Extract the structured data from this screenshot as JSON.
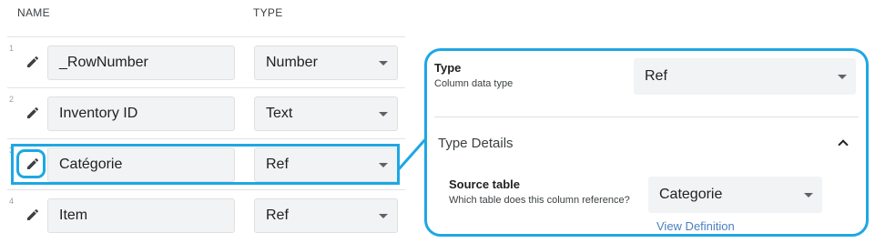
{
  "columns_header": {
    "name": "NAME",
    "type": "TYPE"
  },
  "rows": [
    {
      "index": "1",
      "name": "_RowNumber",
      "type": "Number"
    },
    {
      "index": "2",
      "name": "Inventory ID",
      "type": "Text"
    },
    {
      "index": "3",
      "name": "Catégorie",
      "type": "Ref"
    },
    {
      "index": "4",
      "name": "Item",
      "type": "Ref"
    }
  ],
  "highlighted_row": "3",
  "panel": {
    "type_label": "Type",
    "type_desc": "Column data type",
    "type_value": "Ref",
    "section_title": "Type Details",
    "source_table_label": "Source table",
    "source_table_desc": "Which table does this column reference?",
    "source_table_value": "Categorie",
    "view_definition": "View Definition"
  },
  "colors": {
    "highlight": "#1ea7e4",
    "link": "#4a7fc1",
    "field_bg": "#f1f3f4"
  },
  "icons": {
    "edit": "pencil-icon",
    "dropdown": "chevron-down-icon",
    "collapse": "chevron-up-icon"
  }
}
